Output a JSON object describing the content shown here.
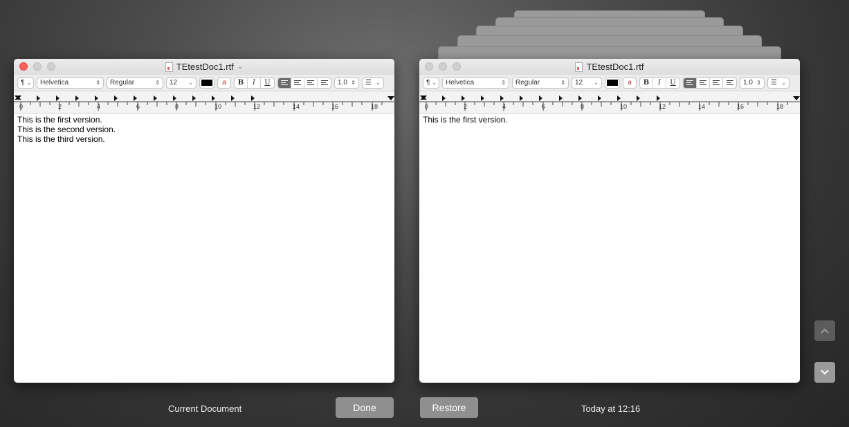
{
  "left_window": {
    "title": "TEtestDoc1.rtf",
    "toolbar": {
      "paragraph": "¶",
      "font_family": "Helvetica",
      "font_style": "Regular",
      "font_size": "12",
      "bold": "B",
      "italic": "I",
      "underline": "U",
      "line_spacing": "1.0"
    },
    "ruler_numbers": [
      "0",
      "2",
      "4",
      "6",
      "8",
      "10",
      "12",
      "14",
      "16",
      "18"
    ],
    "lines": [
      "This is the first version.",
      "This is the second version.",
      "This is the third version."
    ]
  },
  "right_window": {
    "title": "TEtestDoc1.rtf",
    "toolbar": {
      "paragraph": "¶",
      "font_family": "Helvetica",
      "font_style": "Regular",
      "font_size": "12",
      "bold": "B",
      "italic": "I",
      "underline": "U",
      "line_spacing": "1.0"
    },
    "ruler_numbers": [
      "0",
      "2",
      "4",
      "6",
      "8",
      "10",
      "12",
      "14",
      "16",
      "18"
    ],
    "lines": [
      "This is the first version."
    ]
  },
  "footer": {
    "current_label": "Current Document",
    "done_label": "Done",
    "restore_label": "Restore",
    "timestamp": "Today at 12:16"
  },
  "icons": {
    "nav_up": "chevron-up-icon",
    "nav_down": "chevron-down-icon"
  }
}
